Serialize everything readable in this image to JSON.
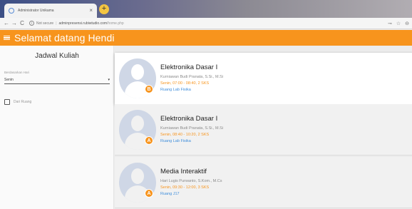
{
  "browser": {
    "tab_title": "Administrator Unikama",
    "tab_close": "×",
    "new_tab": "+",
    "security_text": "Not secure",
    "separator": "|",
    "host": "adminpresensi.rubiwtudio.com",
    "path": "/home.php",
    "nav_back": "←",
    "nav_forward": "→",
    "nav_reload": "C",
    "key_icon": "⊸",
    "star_icon": "☆",
    "account_icon": "⊖"
  },
  "app": {
    "title": "Selamat datang Hendi",
    "accent_color": "#f7941d"
  },
  "sidebar": {
    "title": "Jadwal Kuliah",
    "select_label": "Berdasarkan Hari",
    "select_value": "Senin",
    "select_caret": "▾",
    "checkbox_label": "Dari Ruang"
  },
  "cards": [
    {
      "course": "Elektronika Dasar I",
      "lecturer": "Kurniawan Budi Pranata, S.Si., M.Si",
      "schedule": "Senin, 07:00 - 08:40, 2 SKS",
      "room": "Ruang Lab Fisika",
      "badge": "B",
      "active": true
    },
    {
      "course": "Elektronika Dasar I",
      "lecturer": "Kurniawan Budi Pranata, S.Si., M.Si",
      "schedule": "Senin, 08:40 - 10:20, 2 SKS",
      "room": "Ruang Lab Fisika",
      "badge": "A",
      "active": false
    },
    {
      "course": "Media Interaktif",
      "lecturer": "Hari Lugis Purwanto, S.Kom., M.Cs",
      "schedule": "Senin, 09:30 - 12:00, 3 SKS",
      "room": "Ruang J17",
      "badge": "A",
      "active": false
    }
  ]
}
